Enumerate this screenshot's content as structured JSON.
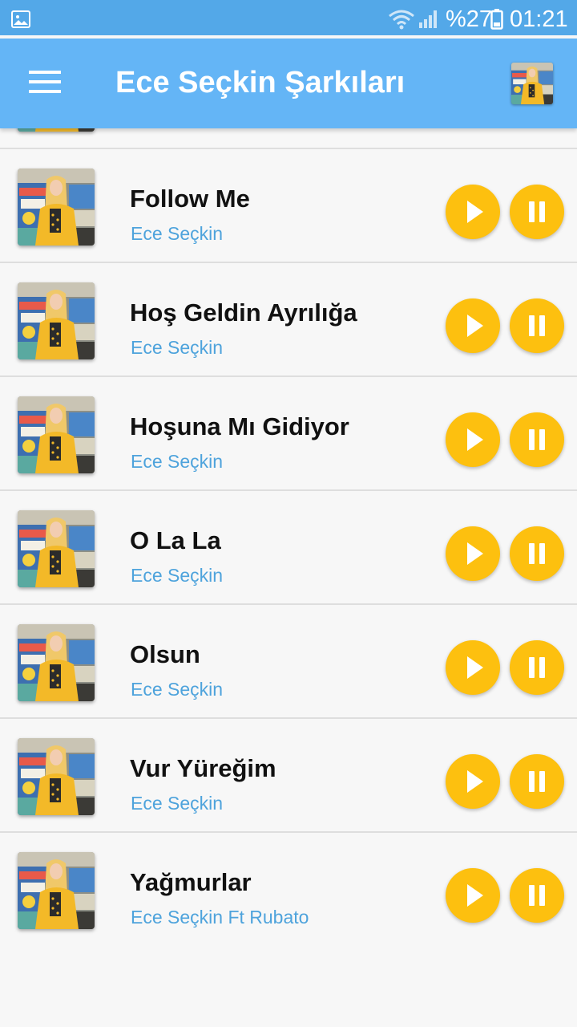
{
  "status_bar": {
    "battery_percent": "%27",
    "time": "01:21",
    "icons": [
      "gallery-icon",
      "wifi-icon",
      "signal-icon",
      "battery-icon"
    ]
  },
  "app_bar": {
    "title": "Ece Seçkin Şarkıları",
    "menu_icon": "hamburger-menu-icon",
    "avatar_icon": "artist-thumbnail"
  },
  "colors": {
    "status_bar": "#53a8e8",
    "app_bar": "#64b5f6",
    "artist_text": "#4ea3dc",
    "button": "#fdc00f",
    "background": "#f7f7f7"
  },
  "songs": [
    {
      "title": "",
      "artist": ""
    },
    {
      "title": "Follow Me",
      "artist": "Ece Seçkin"
    },
    {
      "title": "Hoş Geldin Ayrılığa",
      "artist": "Ece Seçkin"
    },
    {
      "title": "Hoşuna Mı Gidiyor",
      "artist": "Ece Seçkin"
    },
    {
      "title": "O La La",
      "artist": "Ece Seçkin"
    },
    {
      "title": "Olsun",
      "artist": "Ece Seçkin"
    },
    {
      "title": "Vur Yüreğim",
      "artist": "Ece Seçkin"
    },
    {
      "title": "Yağmurlar",
      "artist": "Ece Seçkin Ft Rubato"
    }
  ]
}
